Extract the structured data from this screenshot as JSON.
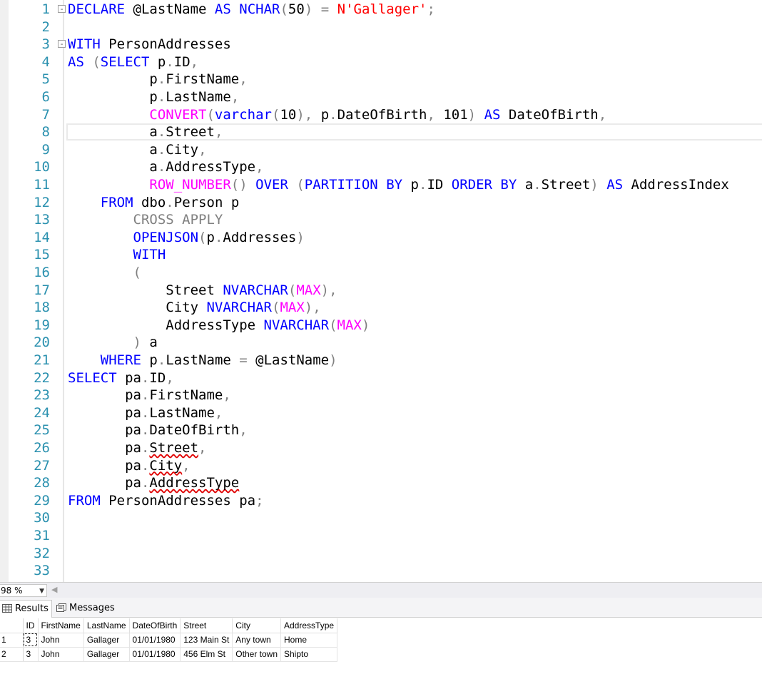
{
  "editor": {
    "lines": [
      {
        "n": "1",
        "fold": "-",
        "tokens": [
          [
            "keyword",
            "DECLARE"
          ],
          [
            "plain",
            " @LastName "
          ],
          [
            "keyword",
            "AS"
          ],
          [
            "plain",
            " "
          ],
          [
            "keyword",
            "NCHAR"
          ],
          [
            "operator",
            "("
          ],
          [
            "plain",
            "50"
          ],
          [
            "operator",
            ")"
          ],
          [
            "plain",
            " "
          ],
          [
            "operator",
            "="
          ],
          [
            "plain",
            " "
          ],
          [
            "string",
            "N'Gallager'"
          ],
          [
            "operator",
            ";"
          ]
        ]
      },
      {
        "n": "2",
        "fold": "",
        "tokens": []
      },
      {
        "n": "3",
        "fold": "-",
        "tokens": [
          [
            "keyword",
            "WITH"
          ],
          [
            "plain",
            " PersonAddresses"
          ]
        ]
      },
      {
        "n": "4",
        "fold": "",
        "tokens": [
          [
            "keyword",
            "AS"
          ],
          [
            "plain",
            " "
          ],
          [
            "operator",
            "("
          ],
          [
            "keyword",
            "SELECT"
          ],
          [
            "plain",
            " p"
          ],
          [
            "operator",
            "."
          ],
          [
            "plain",
            "ID"
          ],
          [
            "operator",
            ","
          ]
        ]
      },
      {
        "n": "5",
        "fold": "",
        "tokens": [
          [
            "plain",
            "          p"
          ],
          [
            "operator",
            "."
          ],
          [
            "plain",
            "FirstName"
          ],
          [
            "operator",
            ","
          ]
        ]
      },
      {
        "n": "6",
        "fold": "",
        "tokens": [
          [
            "plain",
            "          p"
          ],
          [
            "operator",
            "."
          ],
          [
            "plain",
            "LastName"
          ],
          [
            "operator",
            ","
          ]
        ]
      },
      {
        "n": "7",
        "fold": "",
        "tokens": [
          [
            "plain",
            "          "
          ],
          [
            "function",
            "CONVERT"
          ],
          [
            "operator",
            "("
          ],
          [
            "keyword",
            "varchar"
          ],
          [
            "operator",
            "("
          ],
          [
            "plain",
            "10"
          ],
          [
            "operator",
            ")"
          ],
          [
            "operator",
            ","
          ],
          [
            "plain",
            " p"
          ],
          [
            "operator",
            "."
          ],
          [
            "plain",
            "DateOfBirth"
          ],
          [
            "operator",
            ","
          ],
          [
            "plain",
            " 101"
          ],
          [
            "operator",
            ")"
          ],
          [
            "plain",
            " "
          ],
          [
            "keyword",
            "AS"
          ],
          [
            "plain",
            " DateOfBirth"
          ],
          [
            "operator",
            ","
          ]
        ]
      },
      {
        "n": "8",
        "fold": "",
        "tokens": [
          [
            "plain",
            "          a"
          ],
          [
            "operator",
            "."
          ],
          [
            "plain",
            "Street"
          ],
          [
            "operator",
            ","
          ]
        ]
      },
      {
        "n": "9",
        "fold": "",
        "tokens": [
          [
            "plain",
            "          a"
          ],
          [
            "operator",
            "."
          ],
          [
            "plain",
            "City"
          ],
          [
            "operator",
            ","
          ]
        ]
      },
      {
        "n": "10",
        "fold": "",
        "tokens": [
          [
            "plain",
            "          a"
          ],
          [
            "operator",
            "."
          ],
          [
            "plain",
            "AddressType"
          ],
          [
            "operator",
            ","
          ]
        ]
      },
      {
        "n": "11",
        "fold": "",
        "tokens": [
          [
            "plain",
            "          "
          ],
          [
            "function",
            "ROW_NUMBER"
          ],
          [
            "operator",
            "()"
          ],
          [
            "plain",
            " "
          ],
          [
            "keyword",
            "OVER"
          ],
          [
            "plain",
            " "
          ],
          [
            "operator",
            "("
          ],
          [
            "keyword",
            "PARTITION"
          ],
          [
            "plain",
            " "
          ],
          [
            "keyword",
            "BY"
          ],
          [
            "plain",
            " p"
          ],
          [
            "operator",
            "."
          ],
          [
            "plain",
            "ID "
          ],
          [
            "keyword",
            "ORDER"
          ],
          [
            "plain",
            " "
          ],
          [
            "keyword",
            "BY"
          ],
          [
            "plain",
            " a"
          ],
          [
            "operator",
            "."
          ],
          [
            "plain",
            "Street"
          ],
          [
            "operator",
            ")"
          ],
          [
            "plain",
            " "
          ],
          [
            "keyword",
            "AS"
          ],
          [
            "plain",
            " AddressIndex"
          ]
        ]
      },
      {
        "n": "12",
        "fold": "",
        "tokens": [
          [
            "plain",
            "    "
          ],
          [
            "keyword",
            "FROM"
          ],
          [
            "plain",
            " dbo"
          ],
          [
            "operator",
            "."
          ],
          [
            "plain",
            "Person p"
          ]
        ]
      },
      {
        "n": "13",
        "fold": "",
        "tokens": [
          [
            "plain",
            "        "
          ],
          [
            "operator",
            "CROSS APPLY"
          ]
        ]
      },
      {
        "n": "14",
        "fold": "",
        "tokens": [
          [
            "plain",
            "        "
          ],
          [
            "keyword",
            "OPENJSON"
          ],
          [
            "operator",
            "("
          ],
          [
            "plain",
            "p"
          ],
          [
            "operator",
            "."
          ],
          [
            "plain",
            "Addresses"
          ],
          [
            "operator",
            ")"
          ]
        ]
      },
      {
        "n": "15",
        "fold": "",
        "tokens": [
          [
            "plain",
            "        "
          ],
          [
            "keyword",
            "WITH"
          ]
        ]
      },
      {
        "n": "16",
        "fold": "",
        "tokens": [
          [
            "plain",
            "        "
          ],
          [
            "operator",
            "("
          ]
        ]
      },
      {
        "n": "17",
        "fold": "",
        "tokens": [
          [
            "plain",
            "            Street "
          ],
          [
            "keyword",
            "NVARCHAR"
          ],
          [
            "operator",
            "("
          ],
          [
            "function",
            "MAX"
          ],
          [
            "operator",
            ")"
          ],
          [
            "operator",
            ","
          ]
        ]
      },
      {
        "n": "18",
        "fold": "",
        "tokens": [
          [
            "plain",
            "            City "
          ],
          [
            "keyword",
            "NVARCHAR"
          ],
          [
            "operator",
            "("
          ],
          [
            "function",
            "MAX"
          ],
          [
            "operator",
            ")"
          ],
          [
            "operator",
            ","
          ]
        ]
      },
      {
        "n": "19",
        "fold": "",
        "tokens": [
          [
            "plain",
            "            AddressType "
          ],
          [
            "keyword",
            "NVARCHAR"
          ],
          [
            "operator",
            "("
          ],
          [
            "function",
            "MAX"
          ],
          [
            "operator",
            ")"
          ]
        ]
      },
      {
        "n": "20",
        "fold": "",
        "tokens": [
          [
            "plain",
            "        "
          ],
          [
            "operator",
            ")"
          ],
          [
            "plain",
            " a"
          ]
        ]
      },
      {
        "n": "21",
        "fold": "",
        "tokens": [
          [
            "plain",
            "    "
          ],
          [
            "keyword",
            "WHERE"
          ],
          [
            "plain",
            " p"
          ],
          [
            "operator",
            "."
          ],
          [
            "plain",
            "LastName "
          ],
          [
            "operator",
            "="
          ],
          [
            "plain",
            " @LastName"
          ],
          [
            "operator",
            ")"
          ]
        ]
      },
      {
        "n": "22",
        "fold": "",
        "tokens": [
          [
            "keyword",
            "SELECT"
          ],
          [
            "plain",
            " pa"
          ],
          [
            "operator",
            "."
          ],
          [
            "plain",
            "ID"
          ],
          [
            "operator",
            ","
          ]
        ]
      },
      {
        "n": "23",
        "fold": "",
        "tokens": [
          [
            "plain",
            "       pa"
          ],
          [
            "operator",
            "."
          ],
          [
            "plain",
            "FirstName"
          ],
          [
            "operator",
            ","
          ]
        ]
      },
      {
        "n": "24",
        "fold": "",
        "tokens": [
          [
            "plain",
            "       pa"
          ],
          [
            "operator",
            "."
          ],
          [
            "plain",
            "LastName"
          ],
          [
            "operator",
            ","
          ]
        ]
      },
      {
        "n": "25",
        "fold": "",
        "tokens": [
          [
            "plain",
            "       pa"
          ],
          [
            "operator",
            "."
          ],
          [
            "plain",
            "DateOfBirth"
          ],
          [
            "operator",
            ","
          ]
        ]
      },
      {
        "n": "26",
        "fold": "",
        "tokens": [
          [
            "plain",
            "       pa"
          ],
          [
            "operator",
            "."
          ],
          [
            "error",
            "Street"
          ],
          [
            "operator",
            ","
          ]
        ]
      },
      {
        "n": "27",
        "fold": "",
        "tokens": [
          [
            "plain",
            "       pa"
          ],
          [
            "operator",
            "."
          ],
          [
            "error",
            "City"
          ],
          [
            "operator",
            ","
          ]
        ]
      },
      {
        "n": "28",
        "fold": "",
        "tokens": [
          [
            "plain",
            "       pa"
          ],
          [
            "operator",
            "."
          ],
          [
            "error",
            "AddressType"
          ]
        ]
      },
      {
        "n": "29",
        "fold": "",
        "tokens": [
          [
            "keyword",
            "FROM"
          ],
          [
            "plain",
            " PersonAddresses pa"
          ],
          [
            "operator",
            ";"
          ]
        ]
      },
      {
        "n": "30",
        "fold": "",
        "tokens": []
      },
      {
        "n": "31",
        "fold": "",
        "tokens": []
      },
      {
        "n": "32",
        "fold": "",
        "tokens": []
      },
      {
        "n": "33",
        "fold": "",
        "tokens": []
      }
    ],
    "colors": {
      "keyword": "#0000ff",
      "function": "#ff00ff",
      "string": "#ff0000",
      "operator": "#808080",
      "line_number": "#2b91af"
    }
  },
  "status": {
    "zoom": "98 %",
    "zoom_icon": "chevron-down-icon"
  },
  "tabs": [
    {
      "label": "Results",
      "icon": "grid-icon",
      "active": true
    },
    {
      "label": "Messages",
      "icon": "messages-icon",
      "active": false
    }
  ],
  "results": {
    "columns": [
      "",
      "ID",
      "FirstName",
      "LastName",
      "DateOfBirth",
      "Street",
      "City",
      "AddressType"
    ],
    "rows": [
      [
        "1",
        "3",
        "John",
        "Gallager",
        "01/01/1980",
        "123 Main St",
        "Any town",
        "Home"
      ],
      [
        "2",
        "3",
        "John",
        "Gallager",
        "01/01/1980",
        "456 Elm St",
        "Other town",
        "Shipto"
      ]
    ]
  }
}
